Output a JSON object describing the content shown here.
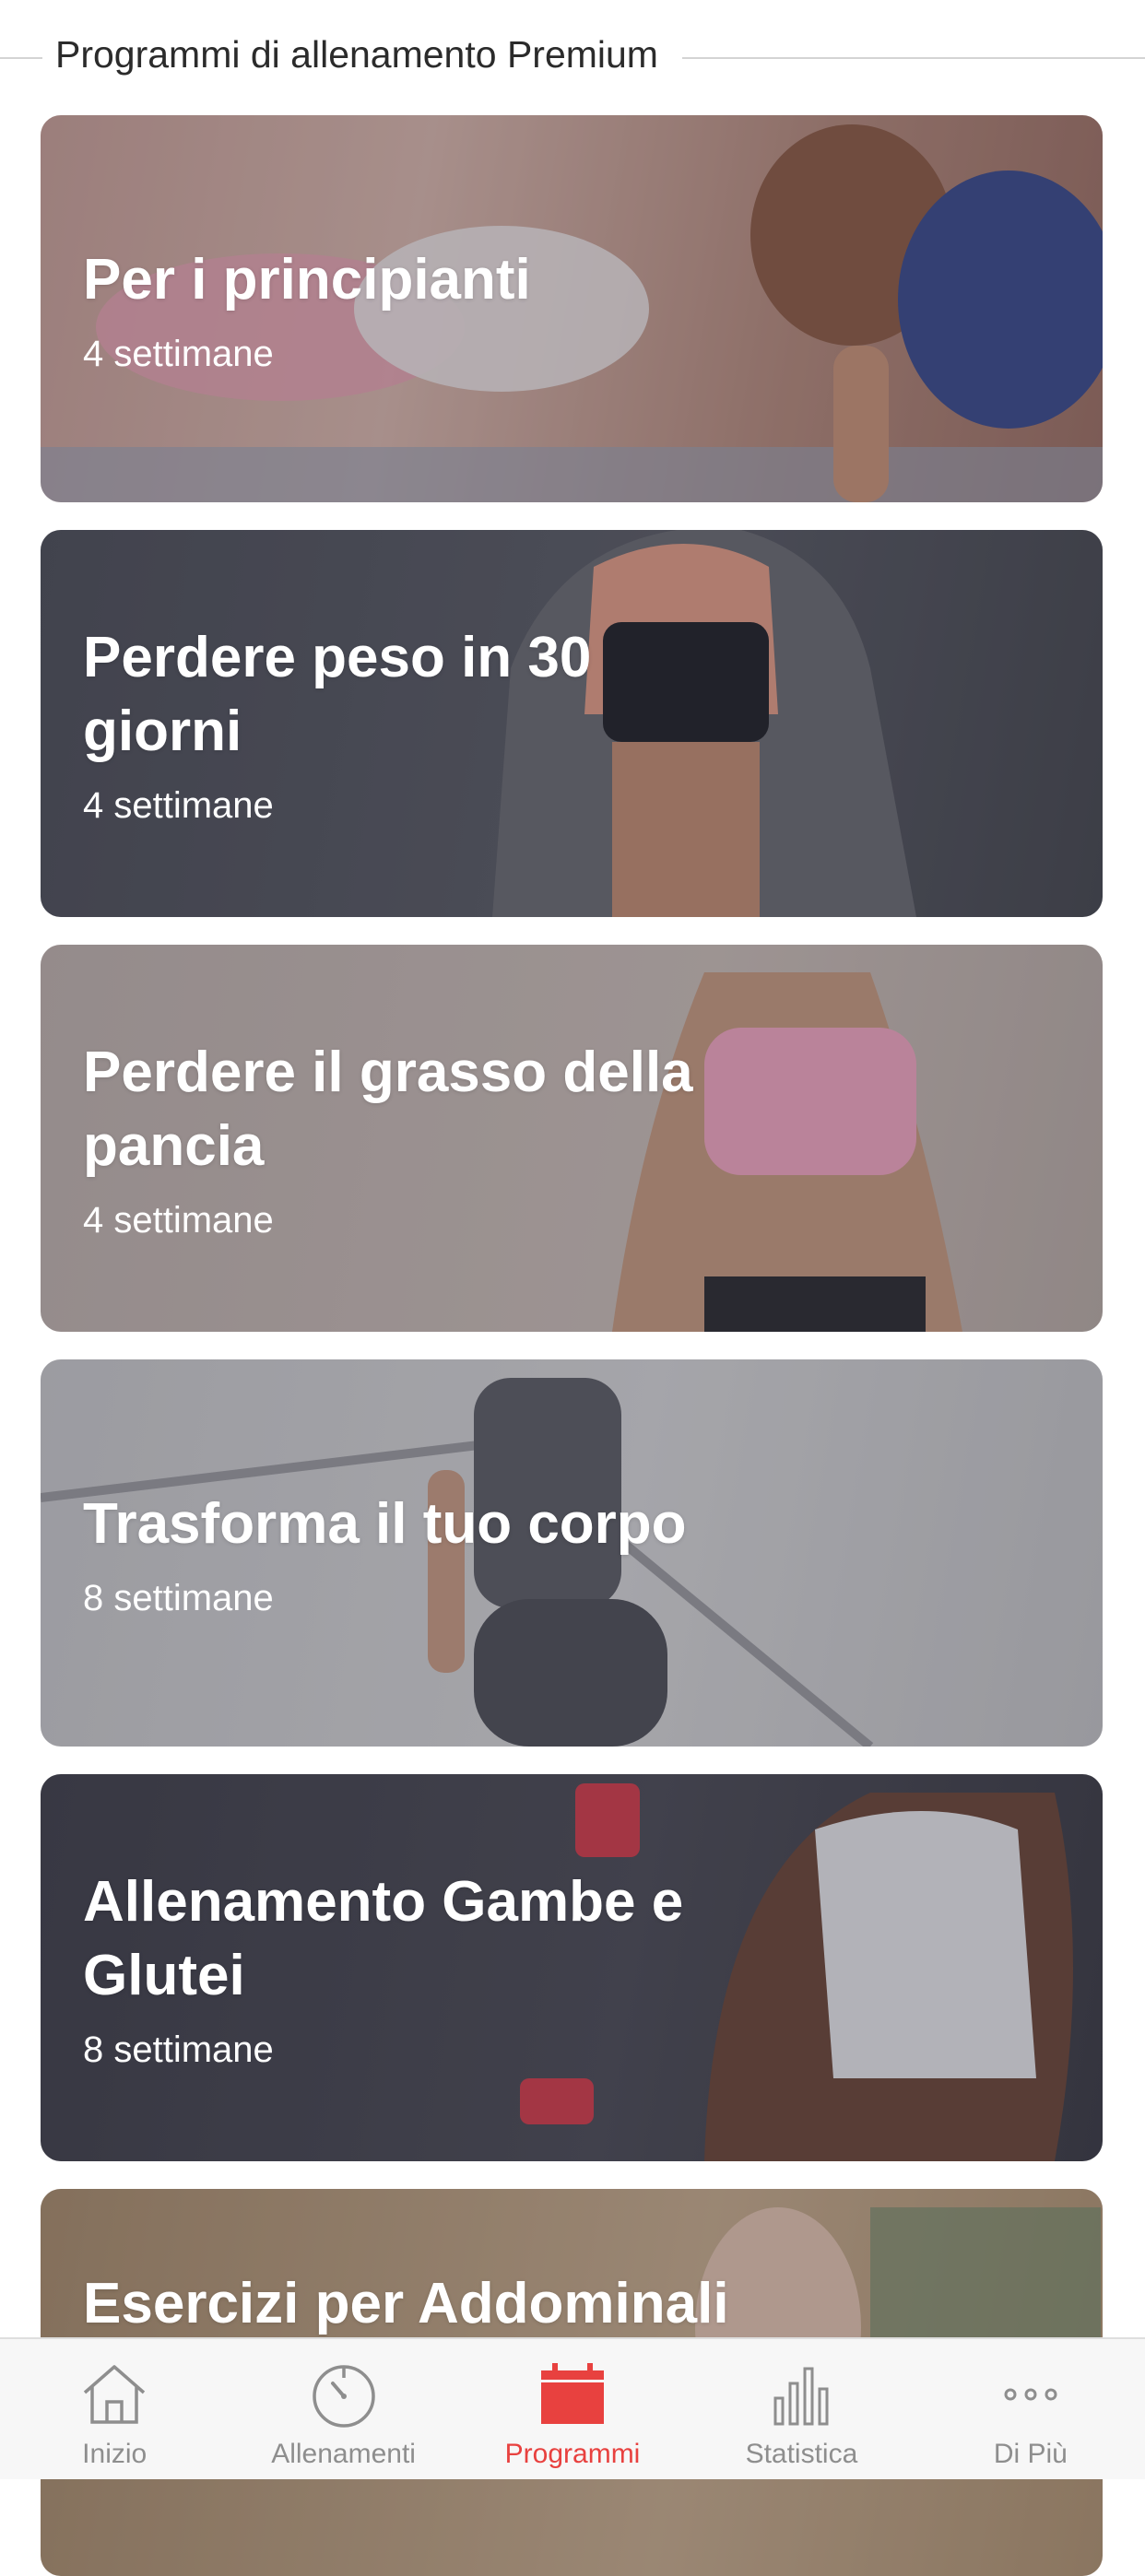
{
  "section": {
    "title": "Programmi di allenamento Premium"
  },
  "programs": [
    {
      "title": "Per i principianti",
      "duration": "4 settimane"
    },
    {
      "title": "Perdere peso in 30 giorni",
      "duration": "4 settimane"
    },
    {
      "title": "Perdere il grasso della pancia",
      "duration": "4 settimane"
    },
    {
      "title": "Trasforma il tuo corpo",
      "duration": "8 settimane"
    },
    {
      "title": "Allenamento Gambe e Glutei",
      "duration": "8 settimane"
    },
    {
      "title": "Esercizi per Addominali",
      "duration": ""
    }
  ],
  "tabbar": {
    "active_color": "#e8413f",
    "inactive_color": "#8e8e8e",
    "tabs": [
      {
        "label": "Inizio",
        "icon": "home-icon"
      },
      {
        "label": "Allenamenti",
        "icon": "stopwatch-icon"
      },
      {
        "label": "Programmi",
        "icon": "calendar-icon"
      },
      {
        "label": "Statistica",
        "icon": "bar-chart-icon"
      },
      {
        "label": "Di Più",
        "icon": "more-icon"
      }
    ]
  }
}
